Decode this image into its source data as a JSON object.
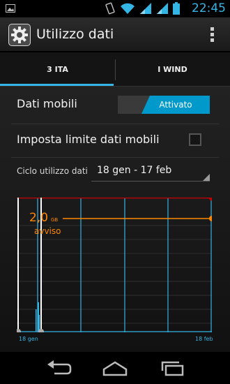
{
  "status_bar": {
    "time": "22:45",
    "icons": [
      "picture-icon",
      "vibrate-icon",
      "wifi-icon",
      "signal-icon",
      "signal-icon",
      "battery-icon"
    ]
  },
  "action_bar": {
    "title": "Utilizzo dati",
    "app_icon": "settings-gear-icon",
    "menu_icon": "overflow-menu-icon"
  },
  "tabs": [
    {
      "label": "3 ITA",
      "selected": true
    },
    {
      "label": "I WIND",
      "selected": false
    }
  ],
  "mobile_data": {
    "label": "Dati mobili",
    "toggle_state": "Attivato"
  },
  "limit": {
    "label": "Imposta limite dati mobili",
    "checked": false
  },
  "cycle": {
    "label": "Ciclo utilizzo dati",
    "value": "18 gen - 17 feb"
  },
  "chart": {
    "warning_value": "2,0",
    "warning_unit": "GB",
    "warning_label": "avviso",
    "x_start": "18 gen",
    "x_end": "18 feb"
  },
  "colors": {
    "accent": "#33b5e5",
    "warning": "#ff8800",
    "limit": "#cc0000"
  },
  "nav_bar": {
    "icons": [
      "back-icon",
      "home-icon",
      "recent-apps-icon"
    ]
  }
}
